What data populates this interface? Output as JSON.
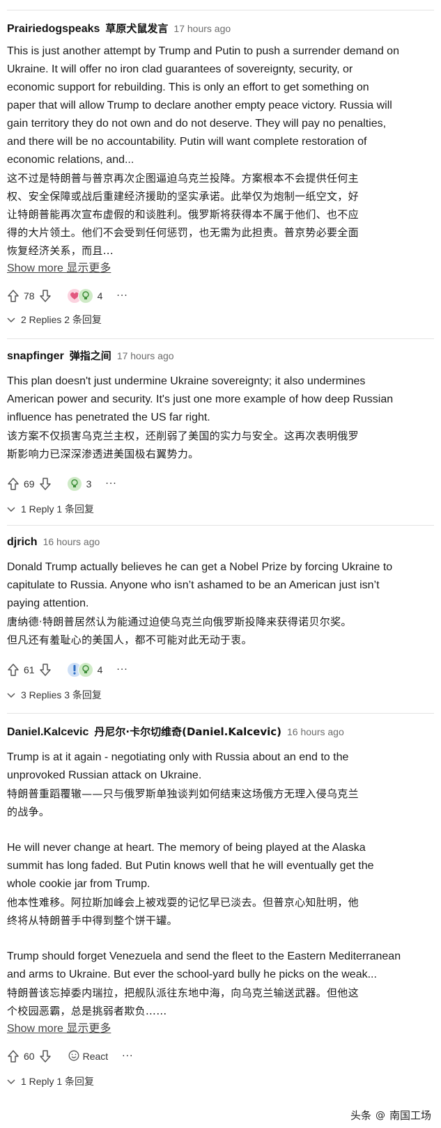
{
  "comments": [
    {
      "username": "Prairiedogspeaks",
      "username_cn": "草原犬鼠发言",
      "timestamp": "17 hours ago",
      "en": [
        "This is just another attempt by Trump and Putin to push a surrender demand on",
        "Ukraine. It will offer no iron clad guarantees of sovereignty, security, or",
        "economic support for rebuilding. This is only an effort to get something on",
        "paper that will allow Trump to declare another empty peace victory. Russia will",
        "gain territory they do not own and do not deserve. They will pay no penalties,",
        "and there will be no accountability. Putin will want complete restoration of",
        "economic relations, and..."
      ],
      "cn": [
        "这不过是特朗普与普京再次企图逼迫乌克兰投降。方案根本不会提供任何主",
        "权、安全保障或战后重建经济援助的坚实承诺。此举仅为炮制一纸空文，好",
        "让特朗普能再次宣布虚假的和谈胜利。俄罗斯将获得本不属于他们、也不应",
        "得的大片领土。他们不会受到任何惩罚，也无需为此担责。普京势必要全面",
        "恢复经济关系，而且..."
      ],
      "show_more": "Show more  显示更多",
      "votes": "78",
      "reaction_count": "4",
      "replies": "2 Replies  2 条回复"
    },
    {
      "username": "snapfinger",
      "username_cn": "弹指之间",
      "timestamp": "17 hours ago",
      "en": [
        "This plan doesn't just undermine Ukraine sovereignty; it also undermines",
        "American power and security. It's just one more example of how deep Russian",
        "influence has penetrated the US far right."
      ],
      "cn": [
        "该方案不仅损害乌克兰主权，还削弱了美国的实力与安全。这再次表明俄罗",
        "斯影响力已深深渗透进美国极右翼势力。"
      ],
      "votes": "69",
      "reaction_count": "3",
      "replies": "1 Reply  1 条回复"
    },
    {
      "username": "djrich",
      "timestamp": "16 hours ago",
      "en": [
        "Donald Trump actually believes he can get a Nobel Prize by forcing Ukraine to",
        "capitulate to Russia. Anyone who isn’t ashamed to be an American just isn’t",
        "paying attention."
      ],
      "cn": [
        "唐纳德·特朗普居然认为能通过迫使乌克兰向俄罗斯投降来获得诺贝尔奖。",
        "但凡还有羞耻心的美国人，都不可能对此无动于衷。"
      ],
      "votes": "61",
      "reaction_count": "4",
      "replies": "3 Replies  3 条回复"
    },
    {
      "username": "Daniel.Kalcevic",
      "username_cn": "丹尼尔·卡尔切维奇(Daniel.Kalcevic)",
      "timestamp": "16 hours ago",
      "p1_en": [
        "Trump is at it again - negotiating only with Russia about an end to the",
        "unprovoked Russian attack on Ukraine."
      ],
      "p1_cn": [
        "特朗普重蹈覆辙——只与俄罗斯单独谈判如何结束这场俄方无理入侵乌克兰",
        "的战争。"
      ],
      "p2_en": [
        "He will never change at heart. The memory of being played at the Alaska",
        "summit has long faded. But Putin knows well that he will eventually get the",
        "whole cookie jar from Trump."
      ],
      "p2_cn": [
        "他本性难移。阿拉斯加峰会上被戏耍的记忆早已淡去。但普京心知肚明，他",
        "终将从特朗普手中得到整个饼干罐。"
      ],
      "p3_en": [
        "Trump should forget Venezuela and send the fleet to the Eastern Mediterranean",
        "and arms to Ukraine. But ever the school-yard bully he picks on the weak..."
      ],
      "p3_cn": [
        "特朗普该忘掉委内瑞拉，把舰队派往东地中海，向乌克兰输送武器。但他这",
        "个校园恶霸，总是挑弱者欺负……"
      ],
      "show_more": "Show more  显示更多",
      "votes": "60",
      "react_label": "React",
      "replies": "1 Reply  1 条回复"
    }
  ],
  "more_label": "···",
  "watermark": {
    "prefix": "头条",
    "at": "@",
    "name": "南国工场"
  },
  "colors": {
    "love": "#f08aa8",
    "insight": "#7cc46f",
    "exclaim": "#6fa8e8"
  }
}
